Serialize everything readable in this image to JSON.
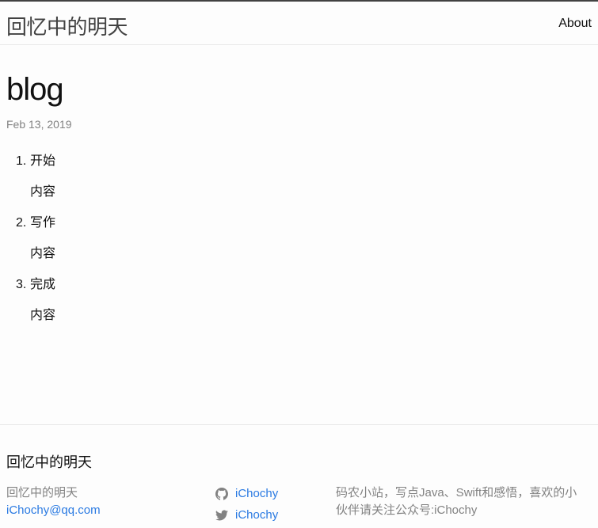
{
  "header": {
    "site_title": "回忆中的明天",
    "nav_about": "About"
  },
  "post": {
    "title": "blog",
    "date": "Feb 13, 2019",
    "items": [
      {
        "num": "1.",
        "title": "开始",
        "body": "内容"
      },
      {
        "num": "2.",
        "title": "写作",
        "body": "内容"
      },
      {
        "num": "3.",
        "title": "完成",
        "body": "内容"
      }
    ]
  },
  "footer": {
    "heading": "回忆中的明天",
    "name": "回忆中的明天",
    "email": "iChochy@qq.com",
    "github": "iChochy",
    "twitter": "iChochy",
    "description": "码农小站，写点Java、Swift和感悟，喜欢的小伙伴请关注公众号:iChochy",
    "colors": {
      "link": "#2a7ae2",
      "muted": "#828282"
    }
  }
}
